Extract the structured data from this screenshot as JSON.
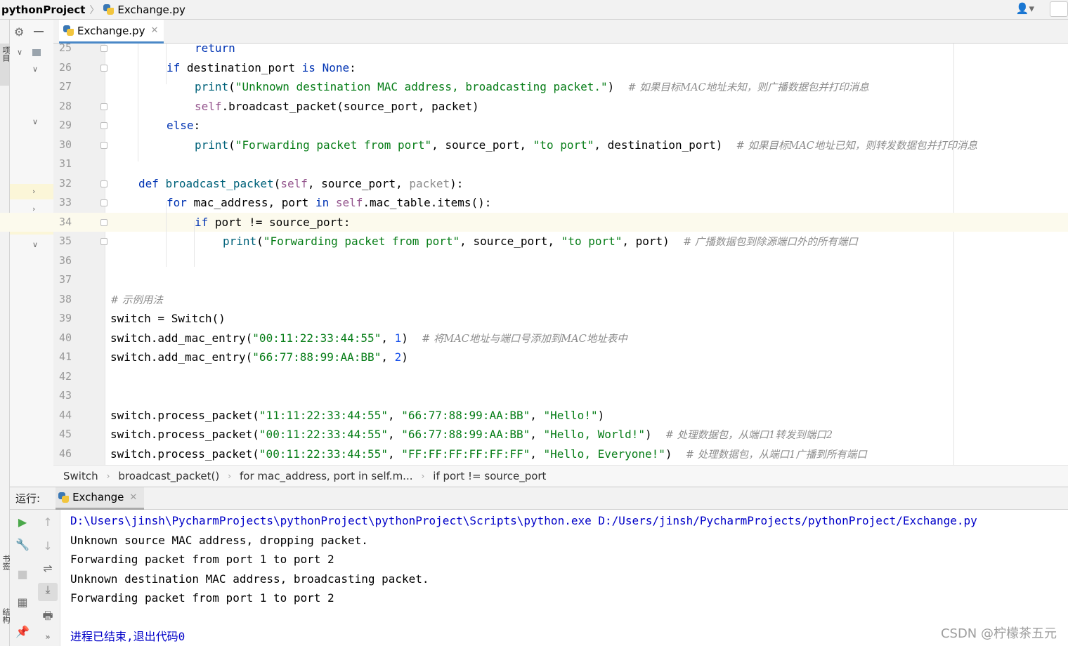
{
  "navbar": {
    "project": "pythonProject",
    "file": "Exchange.py"
  },
  "left_stripe": {
    "project_tab": "项目",
    "bookmarks_tab": "书签",
    "structure_tab": "结构"
  },
  "editor": {
    "tab_label": "Exchange.py",
    "lines": [
      {
        "n": "25",
        "html": "<span class=\"kw\">return</span>",
        "indent": 120
      },
      {
        "n": "26",
        "html": "<span class=\"kw\">if</span> destination_port <span class=\"kw\">is</span> <span class=\"kw\">None</span>:",
        "indent": 80
      },
      {
        "n": "27",
        "html": "<span class=\"fn\">print</span>(<span class=\"str\">\"Unknown destination MAC address, broadcasting packet.\"</span>)  <span class=\"cmt\"># 如果目标MAC地址未知，则广播数据包并打印消息</span>",
        "indent": 120
      },
      {
        "n": "28",
        "html": "<span class=\"slf\">self</span>.broadcast_packet(source_port, packet)",
        "indent": 120
      },
      {
        "n": "29",
        "html": "<span class=\"kw\">else</span>:",
        "indent": 80
      },
      {
        "n": "30",
        "html": "<span class=\"fn\">print</span>(<span class=\"str\">\"Forwarding packet from port\"</span>, source_port, <span class=\"str\">\"to port\"</span>, destination_port)  <span class=\"cmt\"># 如果目标MAC地址已知，则转发数据包并打印消息</span>",
        "indent": 120
      },
      {
        "n": "31",
        "html": "",
        "indent": 0
      },
      {
        "n": "32",
        "html": "<span class=\"kw\">def</span> <span class=\"fn\">broadcast_packet</span>(<span class=\"slf\">self</span>, source_port, <span class=\"dim\">packet</span>):",
        "indent": 40
      },
      {
        "n": "33",
        "html": "<span class=\"kw\">for</span> mac_address, port <span class=\"kw\">in</span> <span class=\"slf\">self</span>.mac_table.items():",
        "indent": 80
      },
      {
        "n": "34",
        "html": "<span class=\"kw\">if</span> port != source_port:",
        "indent": 120,
        "current": true
      },
      {
        "n": "35",
        "html": "<span class=\"fn\">print</span>(<span class=\"str\">\"Forwarding packet from port\"</span>, source_port, <span class=\"str\">\"to port\"</span>, port)  <span class=\"cmt\"># 广播数据包到除源端口外的所有端口</span>",
        "indent": 160
      },
      {
        "n": "36",
        "html": "",
        "indent": 0
      },
      {
        "n": "37",
        "html": "",
        "indent": 0
      },
      {
        "n": "38",
        "html": "<span class=\"cmt\"># 示例用法</span>",
        "indent": 0
      },
      {
        "n": "39",
        "html": "switch = Switch()",
        "indent": 0
      },
      {
        "n": "40",
        "html": "switch.add_mac_entry(<span class=\"str\">\"00:11:22:33:44:55\"</span>, <span class=\"num\">1</span>)  <span class=\"cmt\"># 将MAC地址与端口号添加到MAC地址表中</span>",
        "indent": 0
      },
      {
        "n": "41",
        "html": "switch.add_mac_entry(<span class=\"str\">\"66:77:88:99:AA:BB\"</span>, <span class=\"num\">2</span>)",
        "indent": 0
      },
      {
        "n": "42",
        "html": "",
        "indent": 0
      },
      {
        "n": "43",
        "html": "",
        "indent": 0
      },
      {
        "n": "44",
        "html": "switch.process_packet(<span class=\"str\">\"11:11:22:33:44:55\"</span>, <span class=\"str\">\"66:77:88:99:AA:BB\"</span>, <span class=\"str\">\"Hello!\"</span>)",
        "indent": 0
      },
      {
        "n": "45",
        "html": "switch.process_packet(<span class=\"str\">\"00:11:22:33:44:55\"</span>, <span class=\"str\">\"66:77:88:99:AA:BB\"</span>, <span class=\"str\">\"Hello, World!\"</span>)  <span class=\"cmt\"># 处理数据包，从端口1转发到端口2</span>",
        "indent": 0
      },
      {
        "n": "46",
        "html": "switch.process_packet(<span class=\"str\">\"00:11:22:33:44:55\"</span>, <span class=\"str\">\"FF:FF:FF:FF:FF:FF\"</span>, <span class=\"str\">\"Hello, Everyone!\"</span>)  <span class=\"cmt\"># 处理数据包，从端口1广播到所有端口</span>",
        "indent": 0
      }
    ]
  },
  "breadcrumb": [
    "Switch",
    "broadcast_packet()",
    "for mac_address, port in self.m...",
    "if port != source_port"
  ],
  "run": {
    "label": "运行:",
    "tab": "Exchange",
    "output": [
      {
        "text": "D:\\Users\\jinsh\\PycharmProjects\\pythonProject\\pythonProject\\Scripts\\python.exe D:/Users/jinsh/PycharmProjects/pythonProject/Exchange.py",
        "style": "blue"
      },
      {
        "text": "Unknown source MAC address, dropping packet.",
        "style": "black"
      },
      {
        "text": "Forwarding packet from port 1 to port 2",
        "style": "black"
      },
      {
        "text": "Unknown destination MAC address, broadcasting packet.",
        "style": "black"
      },
      {
        "text": "Forwarding packet from port 1 to port 2",
        "style": "black"
      },
      {
        "text": "",
        "style": "black"
      },
      {
        "text": "进程已结束,退出代码0",
        "style": "blue"
      }
    ]
  },
  "watermark": "CSDN @柠檬茶五元"
}
